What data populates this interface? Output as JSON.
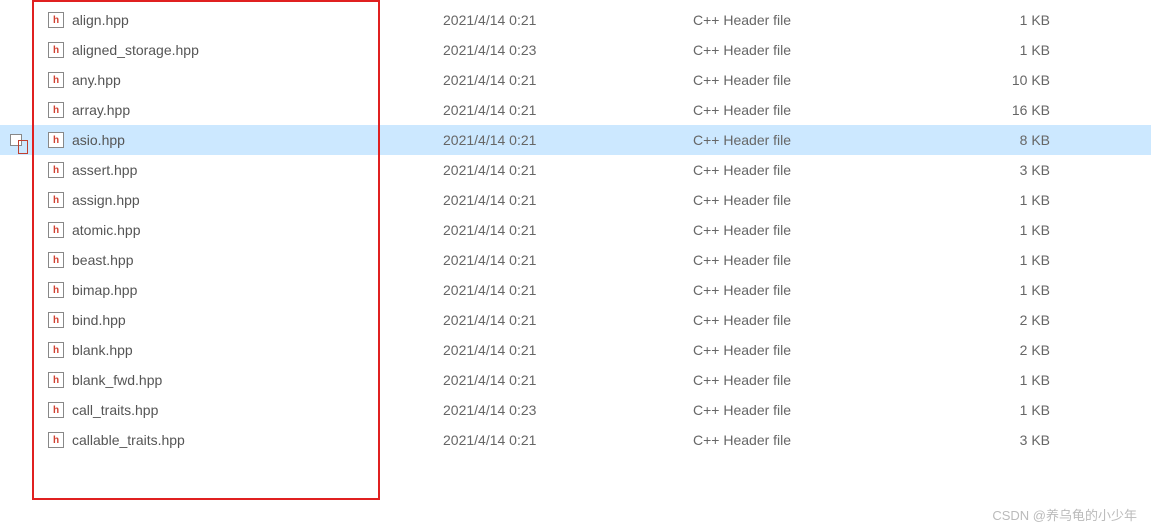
{
  "files": [
    {
      "name": "align.hpp",
      "date": "2021/4/14 0:21",
      "type": "C++ Header file",
      "size": "1 KB",
      "selected": false
    },
    {
      "name": "aligned_storage.hpp",
      "date": "2021/4/14 0:23",
      "type": "C++ Header file",
      "size": "1 KB",
      "selected": false
    },
    {
      "name": "any.hpp",
      "date": "2021/4/14 0:21",
      "type": "C++ Header file",
      "size": "10 KB",
      "selected": false
    },
    {
      "name": "array.hpp",
      "date": "2021/4/14 0:21",
      "type": "C++ Header file",
      "size": "16 KB",
      "selected": false
    },
    {
      "name": "asio.hpp",
      "date": "2021/4/14 0:21",
      "type": "C++ Header file",
      "size": "8 KB",
      "selected": true
    },
    {
      "name": "assert.hpp",
      "date": "2021/4/14 0:21",
      "type": "C++ Header file",
      "size": "3 KB",
      "selected": false
    },
    {
      "name": "assign.hpp",
      "date": "2021/4/14 0:21",
      "type": "C++ Header file",
      "size": "1 KB",
      "selected": false
    },
    {
      "name": "atomic.hpp",
      "date": "2021/4/14 0:21",
      "type": "C++ Header file",
      "size": "1 KB",
      "selected": false
    },
    {
      "name": "beast.hpp",
      "date": "2021/4/14 0:21",
      "type": "C++ Header file",
      "size": "1 KB",
      "selected": false
    },
    {
      "name": "bimap.hpp",
      "date": "2021/4/14 0:21",
      "type": "C++ Header file",
      "size": "1 KB",
      "selected": false
    },
    {
      "name": "bind.hpp",
      "date": "2021/4/14 0:21",
      "type": "C++ Header file",
      "size": "2 KB",
      "selected": false
    },
    {
      "name": "blank.hpp",
      "date": "2021/4/14 0:21",
      "type": "C++ Header file",
      "size": "2 KB",
      "selected": false
    },
    {
      "name": "blank_fwd.hpp",
      "date": "2021/4/14 0:21",
      "type": "C++ Header file",
      "size": "1 KB",
      "selected": false
    },
    {
      "name": "call_traits.hpp",
      "date": "2021/4/14 0:23",
      "type": "C++ Header file",
      "size": "1 KB",
      "selected": false
    },
    {
      "name": "callable_traits.hpp",
      "date": "2021/4/14 0:21",
      "type": "C++ Header file",
      "size": "3 KB",
      "selected": false
    }
  ],
  "icon_letter": "h",
  "watermark": "CSDN @养乌龟的小少年"
}
